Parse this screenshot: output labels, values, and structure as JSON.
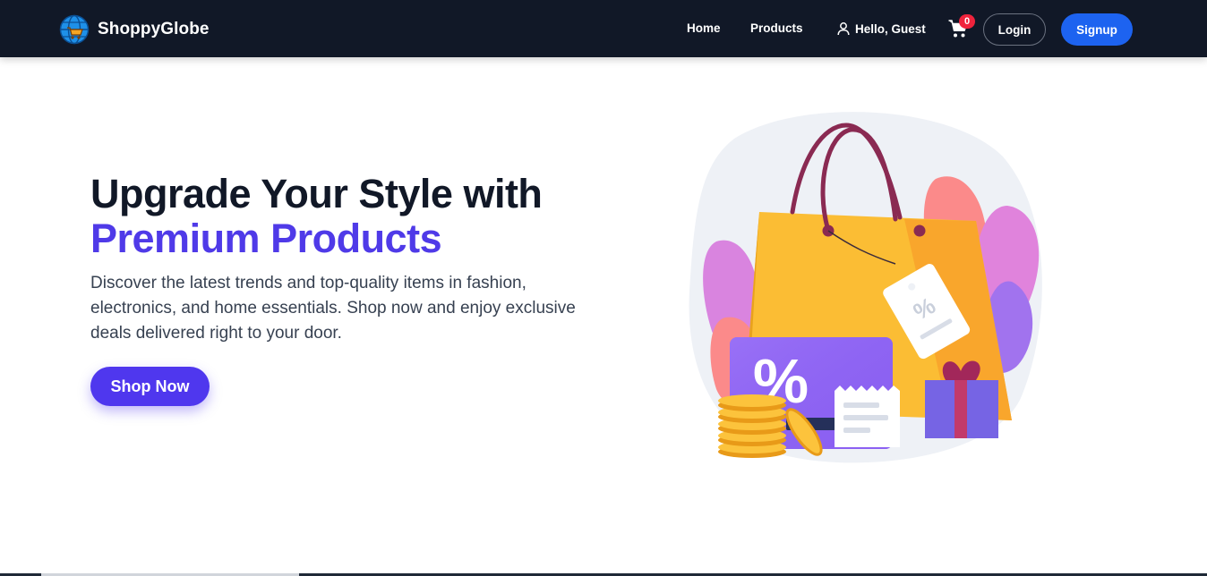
{
  "brand": {
    "name": "ShoppyGlobe",
    "logo_icon": "globe-cart-icon"
  },
  "nav": {
    "links": [
      {
        "label": "Home"
      },
      {
        "label": "Products"
      }
    ],
    "greeting": "Hello, Guest",
    "user_icon": "user-icon",
    "cart_icon": "cart-icon",
    "cart_count": "0",
    "login_label": "Login",
    "signup_label": "Signup"
  },
  "hero": {
    "title_line1": "Upgrade Your Style with",
    "title_line2": "Premium Products",
    "description": "Discover the latest trends and top-quality items in fashion, electronics, and home essentials. Shop now and enjoy exclusive deals delivered right to your door.",
    "cta_label": "Shop Now",
    "illustration": "shopping-bag-illustration"
  },
  "colors": {
    "navbar_bg": "#111827",
    "accent_purple": "#4f3ae8",
    "signup_blue": "#1d63f0",
    "cart_badge_red": "#ef233c"
  }
}
